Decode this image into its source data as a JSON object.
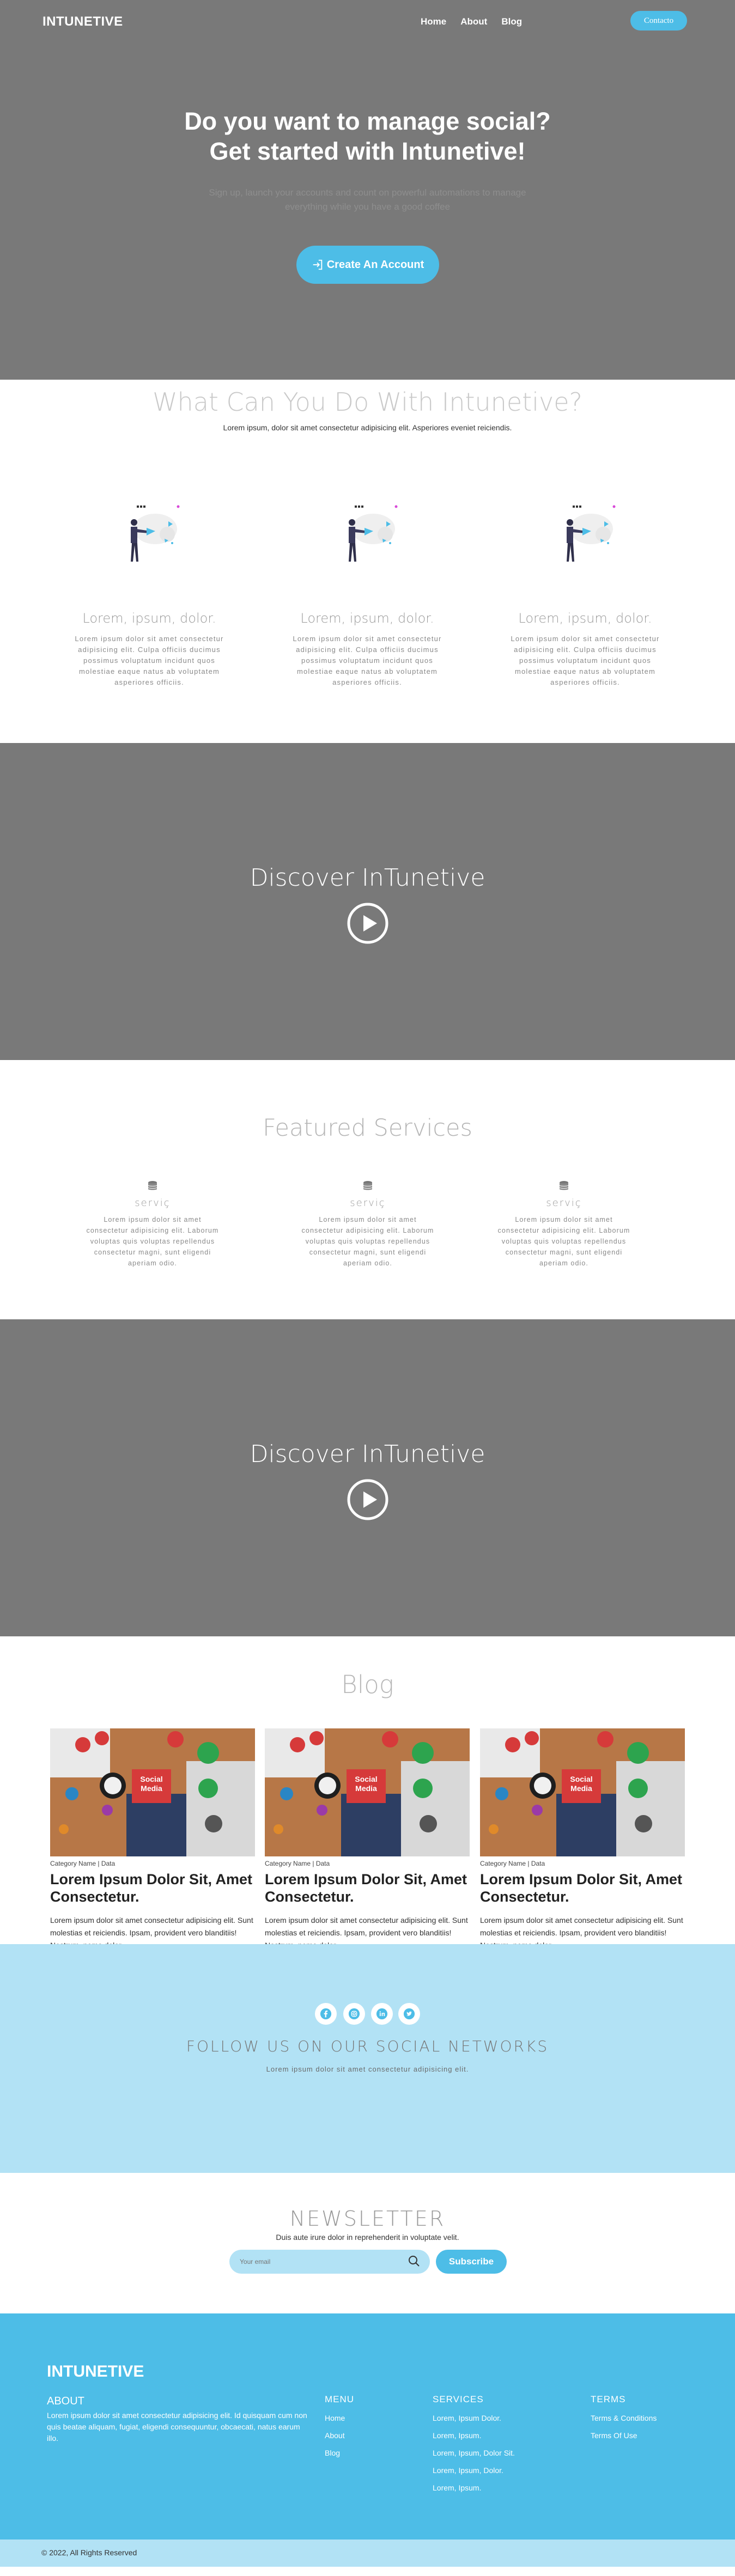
{
  "nav": {
    "brand": "INTUNETIVE",
    "items": [
      "Home",
      "About",
      "Blog"
    ],
    "contact": "Contacto"
  },
  "hero": {
    "title_line1": "Do you want to manage social?",
    "title_line2": "Get started with Intunetive!",
    "sub_line1": "Sign up, launch your accounts and count on powerful automations to manage",
    "sub_line2": "everything while you have a good coffee",
    "cta": "Create An Account"
  },
  "what": {
    "title": "What Can You Do With Intunetive?",
    "subtitle": "Lorem ipsum, dolor sit amet consectetur adipisicing elit. Asperiores eveniet reiciendis.",
    "features": [
      {
        "title": "Lorem, ipsum, dolor.",
        "text": "Lorem ipsum dolor sit amet consectetur adipisicing elit. Culpa officiis ducimus possimus voluptatum incidunt quos molestiae eaque natus ab voluptatem asperiores officiis."
      },
      {
        "title": "Lorem, ipsum, dolor.",
        "text": "Lorem ipsum dolor sit amet consectetur adipisicing elit. Culpa officiis ducimus possimus voluptatum incidunt quos molestiae eaque natus ab voluptatem asperiores officiis."
      },
      {
        "title": "Lorem, ipsum, dolor.",
        "text": "Lorem ipsum dolor sit amet consectetur adipisicing elit. Culpa officiis ducimus possimus voluptatum incidunt quos molestiae eaque natus ab voluptatem asperiores officiis."
      }
    ]
  },
  "video1": {
    "title": "Discover InTunetive"
  },
  "services": {
    "title": "Featured Services",
    "items": [
      {
        "title": "serviç",
        "text": "Lorem ipsum dolor sit amet consectetur adipisicing elit. Laborum voluptas quis voluptas repellendus consectetur magni, sunt eligendi aperiam odio."
      },
      {
        "title": "serviç",
        "text": "Lorem ipsum dolor sit amet consectetur adipisicing elit. Laborum voluptas quis voluptas repellendus consectetur magni, sunt eligendi aperiam odio."
      },
      {
        "title": "serviç",
        "text": "Lorem ipsum dolor sit amet consectetur adipisicing elit. Laborum voluptas quis voluptas repellendus consectetur magni, sunt eligendi aperiam odio."
      }
    ]
  },
  "video2": {
    "title": "Discover InTunetive"
  },
  "blog": {
    "title": "Blog",
    "posts": [
      {
        "badge": "Social Media",
        "category": "Category Name | Data",
        "title": "Lorem Ipsum Dolor Sit, Amet Consectetur.",
        "text": "Lorem ipsum dolor sit amet consectetur adipisicing elit. Sunt molestias et reiciendis. Ipsam, provident vero blanditiis! Nostrum, nemo dolor."
      },
      {
        "badge": "Social Media",
        "category": "Category Name | Data",
        "title": "Lorem Ipsum Dolor Sit, Amet Consectetur.",
        "text": "Lorem ipsum dolor sit amet consectetur adipisicing elit. Sunt molestias et reiciendis. Ipsam, provident vero blanditiis! Nostrum, nemo dolor."
      },
      {
        "badge": "Social Media",
        "category": "Category Name | Data",
        "title": "Lorem Ipsum Dolor Sit, Amet Consectetur.",
        "text": "Lorem ipsum dolor sit amet consectetur adipisicing elit. Sunt molestias et reiciendis. Ipsam, provident vero blanditiis! Nostrum, nemo dolor."
      }
    ]
  },
  "follow": {
    "title": "FOLLOW US ON OUR SOCIAL NETWORKS",
    "text": "Lorem ipsum dolor sit amet consectetur adipisicing elit.",
    "icons": [
      "facebook-icon",
      "instagram-icon",
      "linkedin-icon",
      "twitter-icon"
    ]
  },
  "newsletter": {
    "title": "NEWSLETTER",
    "text": "Duis aute irure dolor in reprehenderit in voluptate velit.",
    "placeholder": "Your email",
    "button": "Subscribe"
  },
  "footer": {
    "brand": "INTUNETIVE",
    "about_title": "ABOUT",
    "about_text": "Lorem ipsum dolor sit amet consectetur adipisicing elit. Id quisquam cum non quis beatae aliquam, fugiat, eligendi consequuntur, obcaecati, natus earum illo.",
    "menu_title": "MENU",
    "menu": [
      "Home",
      "About",
      "Blog"
    ],
    "services_title": "SERVICES",
    "services": [
      "Lorem, Ipsum Dolor.",
      "Lorem, Ipsum.",
      "Lorem, Ipsum, Dolor Sit.",
      "Lorem, Ipsum, Dolor.",
      "Lorem, Ipsum."
    ],
    "terms_title": "TERMS",
    "terms": [
      "Terms & Conditions",
      "Terms Of Use"
    ],
    "copyright": "© 2022, All Rights Reserved"
  },
  "colors": {
    "accent": "#4dbde7",
    "light_accent": "#b2e2f5",
    "hero_bg": "#797979"
  }
}
